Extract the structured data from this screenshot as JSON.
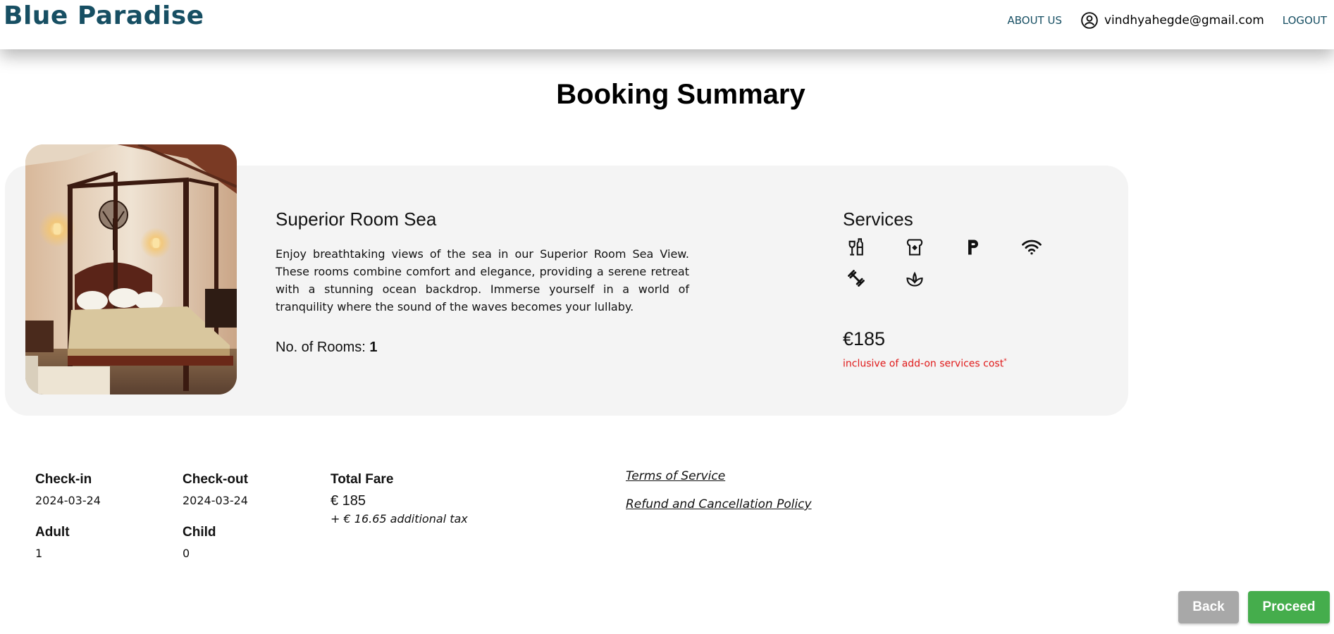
{
  "header": {
    "brand": "Blue Paradise",
    "about_label": "ABOUT US",
    "user_email": "vindhyahegde@gmail.com",
    "logout_label": "LOGOUT"
  },
  "page": {
    "title": "Booking Summary"
  },
  "room": {
    "name": "Superior Room Sea",
    "description": "Enjoy breathtaking views of the sea in our Superior Room Sea View. These rooms combine comfort and elegance, providing a serene retreat with a stunning ocean backdrop. Immerse yourself in a world of tranquility where the sound of the waves becomes your lullaby.",
    "rooms_label": "No. of Rooms: ",
    "rooms_count": "1"
  },
  "services": {
    "title": "Services",
    "icons": [
      "bar-icon",
      "toast-icon",
      "parking-icon",
      "wifi-icon",
      "gym-icon",
      "spa-icon"
    ],
    "price": "€185",
    "price_note": "inclusive of add-on services cost",
    "price_note_mark": "*"
  },
  "details": {
    "checkin_label": "Check-in",
    "checkin_value": "2024-03-24",
    "checkout_label": "Check-out",
    "checkout_value": "2024-03-24",
    "adult_label": "Adult",
    "adult_value": "1",
    "child_label": "Child",
    "child_value": "0",
    "fare_label": "Total Fare",
    "fare_value": "€ 185",
    "fare_tax": "+ € 16.65 additional tax"
  },
  "links": {
    "terms": "Terms of Service",
    "refund": "Refund and Cancellation Policy"
  },
  "actions": {
    "back_label": "Back",
    "proceed_label": "Proceed"
  },
  "colors": {
    "brand": "#174f63",
    "card_bg": "#f4f4f4",
    "note_red": "#e01a1a",
    "back_btn": "#a8a8a8",
    "proceed_btn": "#45ad4c"
  }
}
